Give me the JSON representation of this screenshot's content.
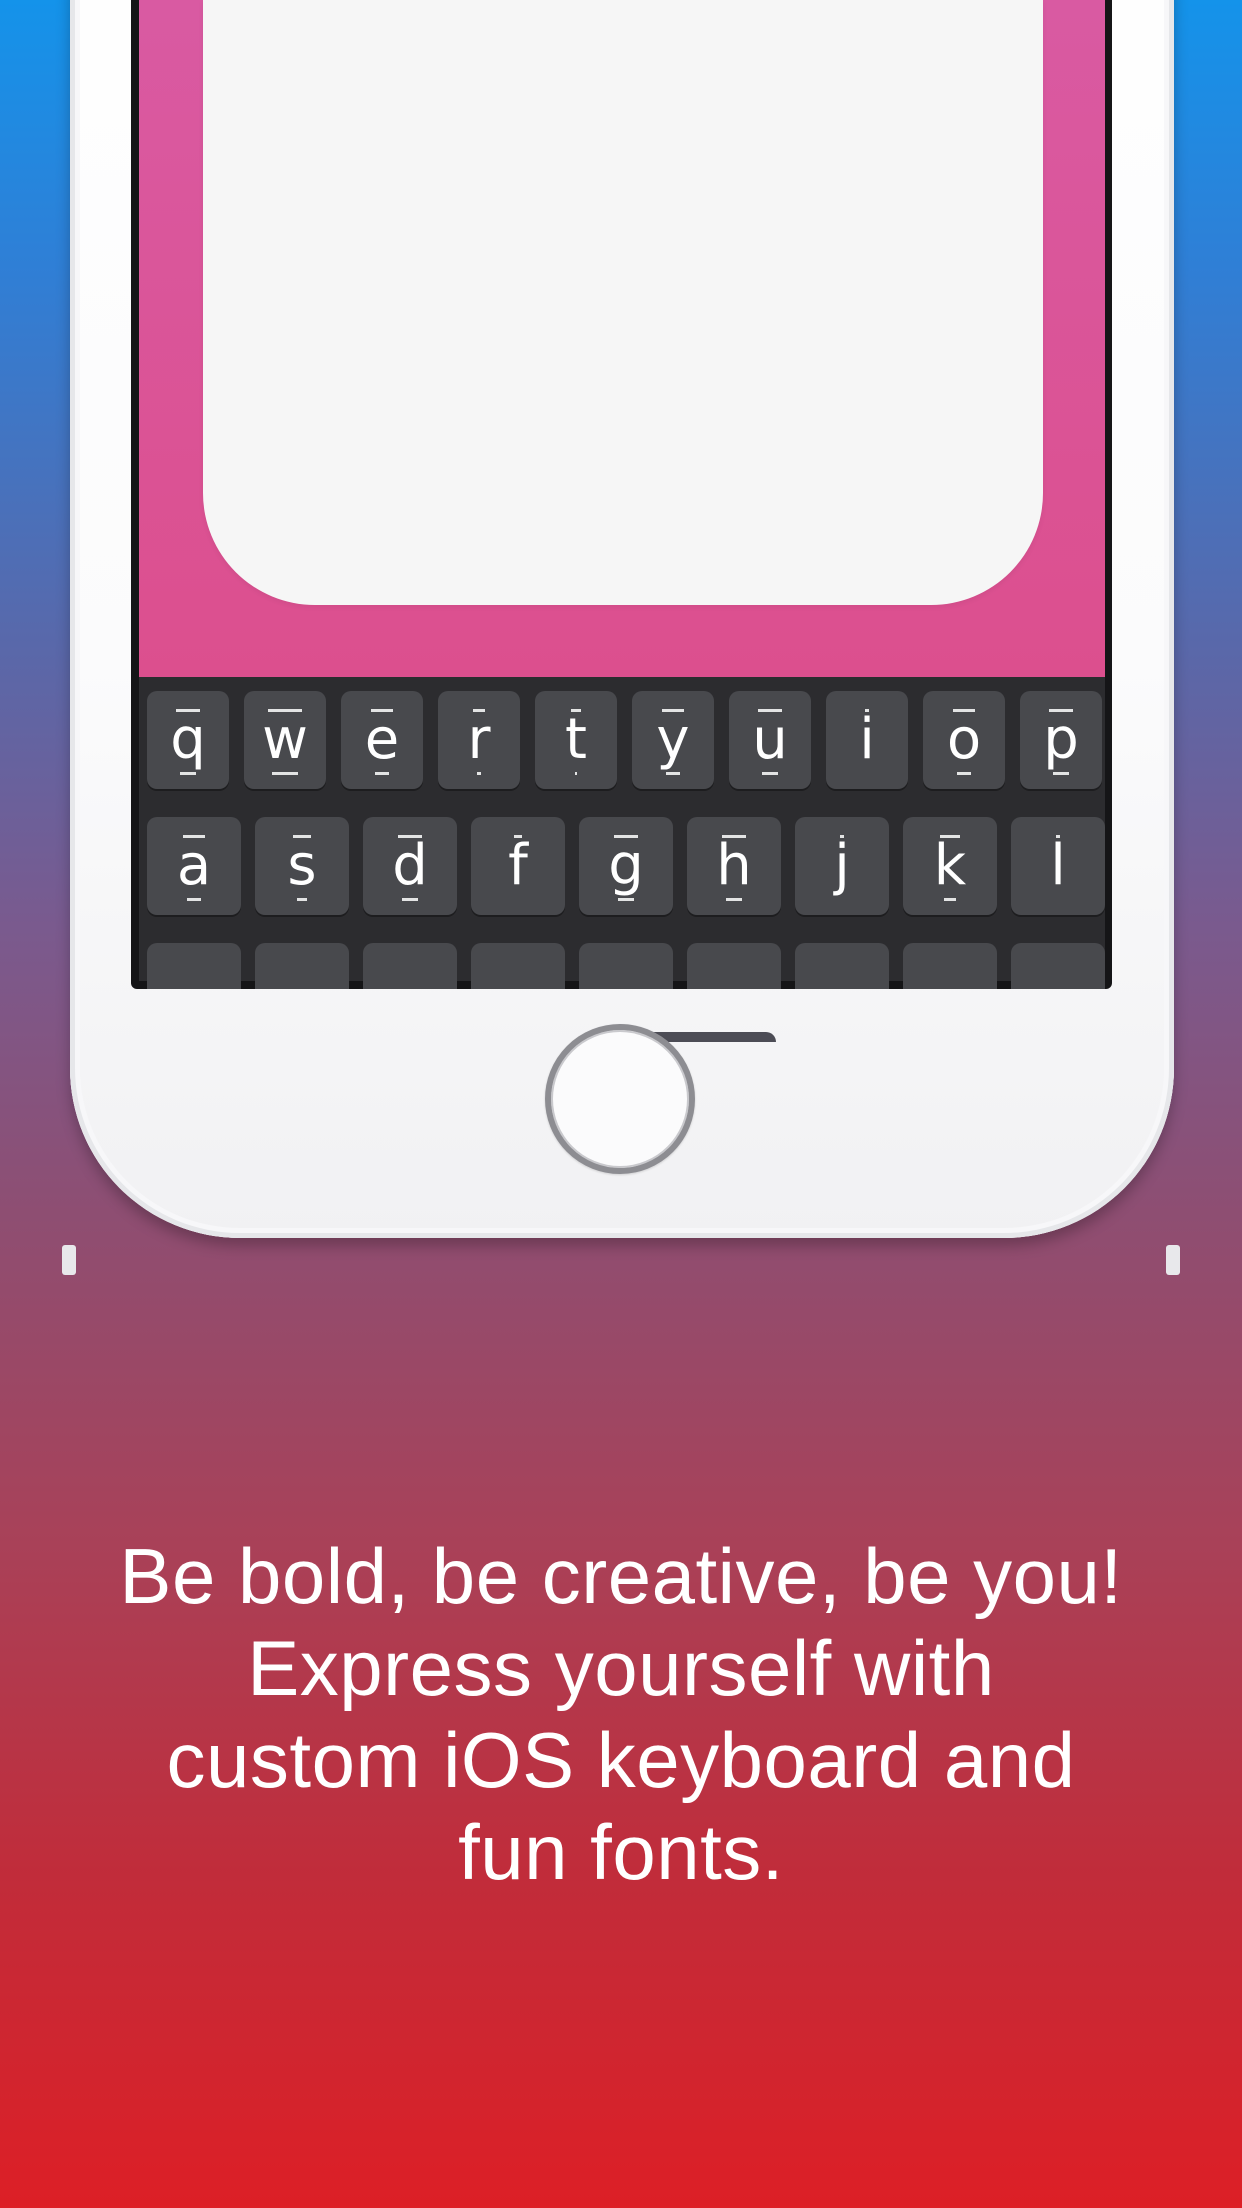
{
  "keyboard": {
    "row1": [
      "q",
      "w",
      "e",
      "r",
      "t",
      "y",
      "u",
      "i",
      "o",
      "p"
    ],
    "row2": [
      "a",
      "s",
      "d",
      "f",
      "g",
      "h",
      "j",
      "k",
      "l"
    ]
  },
  "tagline": {
    "line1": "Be bold, be creative, be you!",
    "line2": "Express yourself with",
    "line3": "custom iOS keyboard and",
    "line4": "fun fonts."
  }
}
